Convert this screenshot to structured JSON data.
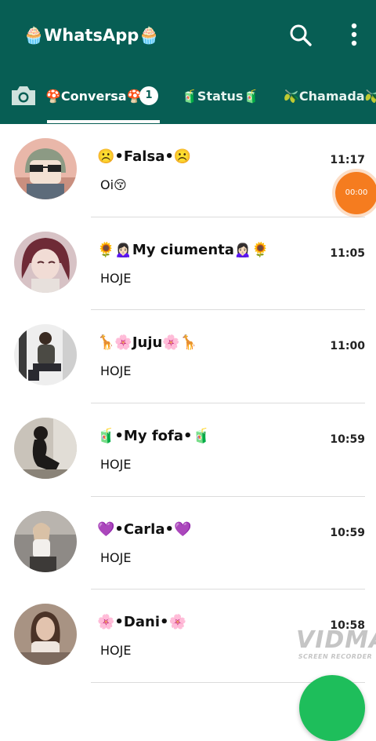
{
  "header": {
    "title": "🧁WhatsApp🧁",
    "bg_color": "#075e54",
    "search_icon": "search-icon",
    "menu_icon": "more-vert-icon"
  },
  "tabs": {
    "camera_icon": "camera-icon",
    "chats_label": "🍄Conversa🍄",
    "chats_unread": "1",
    "status_label": "🧃Status🧃",
    "calls_label": "🫒Chamada🫒"
  },
  "chats": [
    {
      "name": "☹️•Falsa•☹️",
      "time": "11:17",
      "preview": "Oi😚"
    },
    {
      "name": "🌻🙍🏻‍♀️My ciumenta🙍🏻‍♀️🌻",
      "time": "11:05",
      "preview": "HOJE"
    },
    {
      "name": "🦒🌸Juju🌸🦒",
      "time": "11:00",
      "preview": "HOJE"
    },
    {
      "name": "🧃•My fofa•🧃",
      "time": "10:59",
      "preview": "HOJE"
    },
    {
      "name": "💜•Carla•💜",
      "time": "10:59",
      "preview": "HOJE"
    },
    {
      "name": "🌸•Dani•🌸",
      "time": "10:58",
      "preview": "HOJE"
    }
  ],
  "recorder": {
    "timer": "00:00",
    "color": "#f57c1f"
  },
  "watermark": {
    "logo": "VIDMA",
    "sub": "SCREEN RECORDER"
  },
  "fab": {
    "color": "#1ebe5b"
  }
}
